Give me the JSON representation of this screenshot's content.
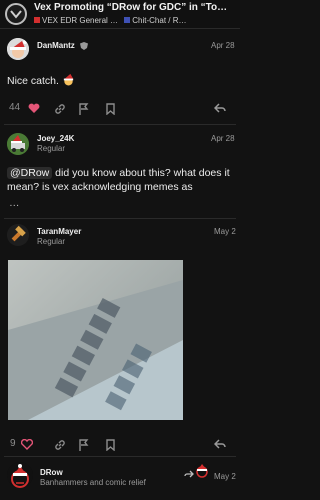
{
  "header": {
    "title": "Vex Promoting “DRow for GDC” in “Tower T…",
    "crumb_1": "VEX EDR General …",
    "crumb_2": "Chit-Chat / R…",
    "crumb_1_color": "#d32f2f",
    "crumb_2_color": "#3f51b5"
  },
  "posts": [
    {
      "username": "DanMantz",
      "date": "Apr 28",
      "body": "Nice catch.",
      "likes": "44"
    },
    {
      "username": "Joey_24K",
      "subtitle": "Regular",
      "date": "Apr 28",
      "mention": "@DRow",
      "body": " did you know about this? what does it mean? is vex acknowledging memes as",
      "more": "…"
    },
    {
      "username": "TaranMayer",
      "subtitle": "Regular",
      "date": "May 2",
      "likes": "9"
    },
    {
      "username": "DRow",
      "subtitle": "Banhammers and comic relief",
      "date": "May 2"
    }
  ],
  "colors": {
    "like_heart": "#e45577",
    "background": "#121212"
  }
}
